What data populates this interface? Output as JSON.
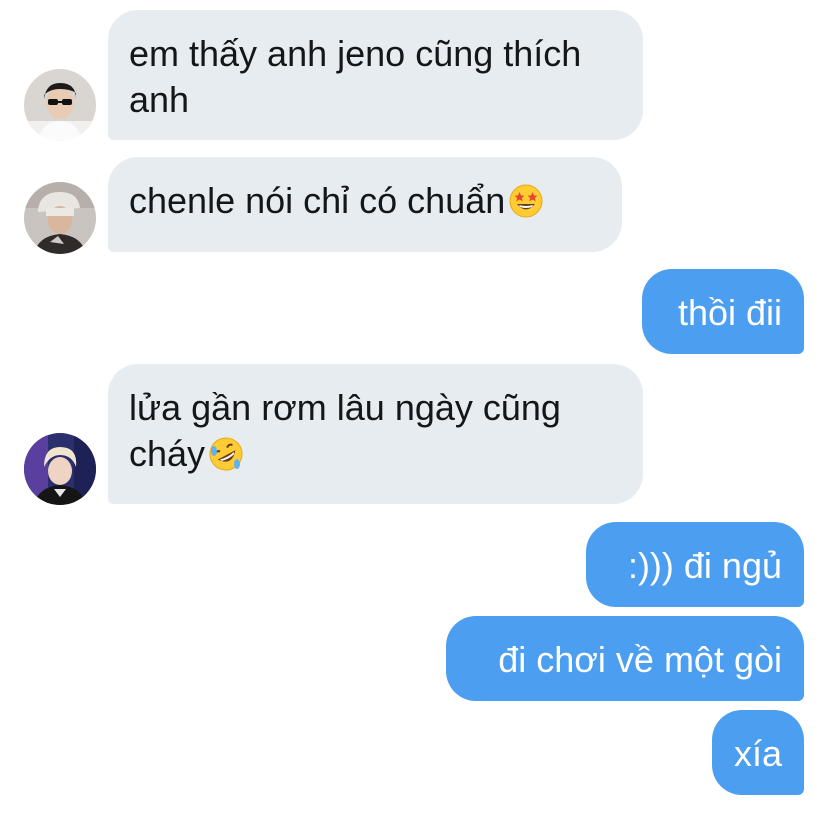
{
  "messages": [
    {
      "side": "incoming",
      "text": "em thấy anh jeno cũng thích anh",
      "avatar_icon": "avatar-boy-sunglasses-icon"
    },
    {
      "side": "incoming",
      "text": "chenle nói chỉ có chuẩn",
      "emoji": "star-struck-emoji-icon",
      "avatar_icon": "avatar-boy-cap-icon"
    },
    {
      "side": "outgoing",
      "text": "thồi đii"
    },
    {
      "side": "incoming",
      "text": "lửa gần rơm lâu ngày cũng cháy",
      "emoji": "rolling-on-floor-laughing-emoji-icon",
      "avatar_icon": "avatar-boy-blond-icon"
    },
    {
      "side": "outgoing",
      "text": ":))) đi ngủ"
    },
    {
      "side": "outgoing",
      "text": "đi chơi về một gòi"
    },
    {
      "side": "outgoing",
      "text": "xía"
    }
  ],
  "colors": {
    "incoming_bubble": "#e6ecf0",
    "outgoing_bubble": "#4c9ef0",
    "incoming_text": "#14171a",
    "outgoing_text": "#ffffff"
  }
}
